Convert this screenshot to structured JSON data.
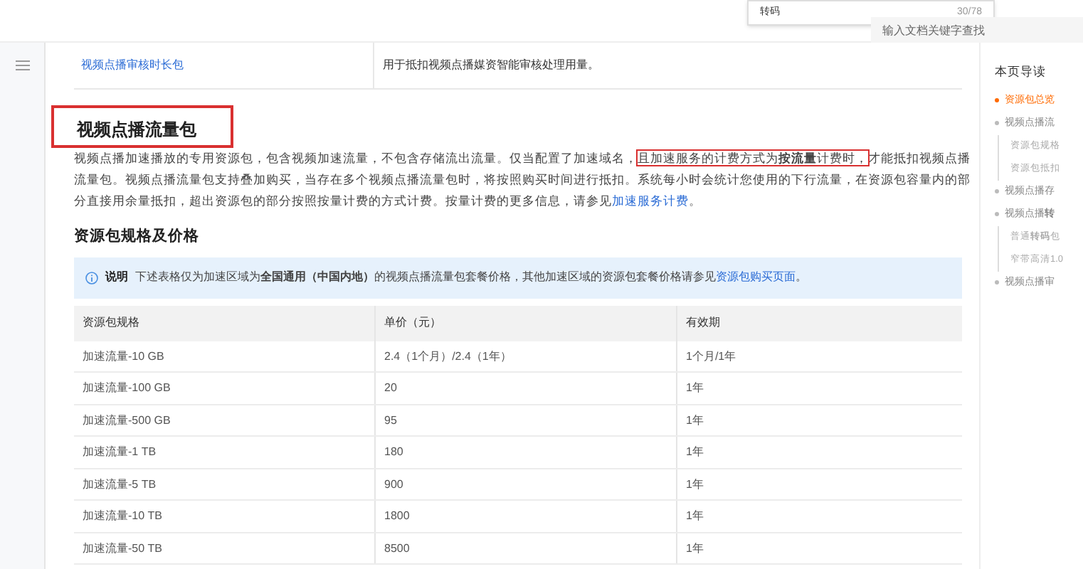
{
  "find_bar": {
    "query": "转码",
    "count": "30/78"
  },
  "search": {
    "placeholder": "输入文档关键字查找"
  },
  "prev_row": {
    "name": "视频点播审核时长包",
    "description": "用于抵扣视频点播媒资智能审核处理用量。"
  },
  "section": {
    "title": "视频点播流量包",
    "annotated": true,
    "paragraph": [
      {
        "text": "视频点播加速播放的专用资源包，包含视频加速流量，不包含存储流出流量。仅当配置了加速域名，",
        "annotated": false
      },
      {
        "text": "且加速服务的计费方式为**按流量**计费时，",
        "annotated": true
      },
      {
        "text": "才能抵扣视频点播流量包。视频点播流量包支持叠加购买，当存在多个视频点播流量包时，将按照购买时间进行抵扣。系统每小时会统计您使用的下行流量，在资源包容量内的部分直接用余量抵扣，超出资源包的部分按照按量计费的方式计费。按量计费的更多信息，请参见",
        "annotated": false
      }
    ],
    "link": "加速服务计费",
    "end": "。"
  },
  "subsection": {
    "title": "资源包规格及价格"
  },
  "note": {
    "label": "说明",
    "text": "下述表格仅为加速区域为**全国通用（中国内地）**的视频点播流量包套餐价格，其他加速区域的资源包套餐价格请参见",
    "link": "资源包购买页面",
    "end": "。"
  },
  "table": {
    "columns": [
      "资源包规格",
      "单价（元）",
      "有效期"
    ],
    "rows": [
      [
        "加速流量-10 GB",
        "2.4（1个月）/2.4（1年）",
        "1个月/1年"
      ],
      [
        "加速流量-100 GB",
        "20",
        "1年"
      ],
      [
        "加速流量-500 GB",
        "95",
        "1年"
      ],
      [
        "加速流量-1 TB",
        "180",
        "1年"
      ],
      [
        "加速流量-5 TB",
        "900",
        "1年"
      ],
      [
        "加速流量-10 TB",
        "1800",
        "1年"
      ],
      [
        "加速流量-50 TB",
        "8500",
        "1年"
      ]
    ]
  },
  "toc": {
    "title": "本页导读",
    "items": [
      {
        "text": "资源包总览",
        "selected": true
      },
      {
        "text": "视频点播流",
        "selected": false,
        "children": [
          {
            "text": "资源包规格",
            "selected": false
          },
          {
            "text": "资源包抵扣",
            "selected": false
          }
        ]
      },
      {
        "text": "视频点播存",
        "selected": false
      },
      {
        "text": "视频点播**转**",
        "selected": false,
        "children": [
          {
            "text": "普通**转码**包",
            "selected": false
          },
          {
            "text": "窄带高清1.0",
            "selected": false
          }
        ]
      },
      {
        "text": "视频点播审",
        "selected": false
      }
    ]
  }
}
